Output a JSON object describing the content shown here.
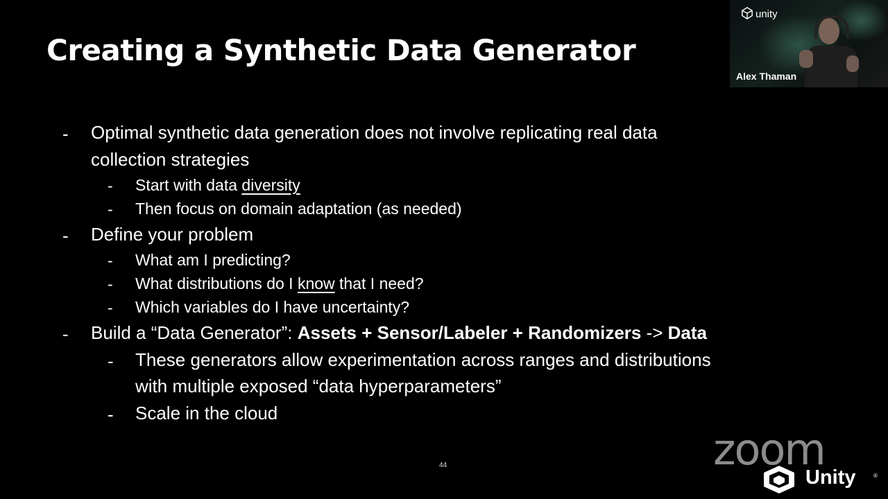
{
  "slide": {
    "title": "Creating a Synthetic Data Generator",
    "page_number": "44",
    "bullets": {
      "b1_line1": "Optimal synthetic data generation does not involve replicating real data",
      "b1_line2": "collection strategies",
      "b1_sub1_prefix": "Start with data ",
      "b1_sub1_underline": "diversity",
      "b1_sub2": "Then focus on domain adaptation (as needed)",
      "b2": "Define your problem",
      "b2_sub1": "What am I predicting?",
      "b2_sub2_prefix": "What distributions do I ",
      "b2_sub2_underline": "know",
      "b2_sub2_suffix": " that I need?",
      "b2_sub3": "Which variables do I have uncertainty?",
      "b3_prefix": "Build a “Data Generator”:  ",
      "b3_bold1": "Assets + Sensor/Labeler + Randomizers",
      "b3_arrow": " -> ",
      "b3_bold2": "Data",
      "b3_sub1_line1": "These generators allow experimentation across ranges and distributions",
      "b3_sub1_line2": "with multiple exposed “data hyperparameters”",
      "b3_sub2": "Scale in the cloud"
    },
    "dash": "-"
  },
  "video": {
    "logo_text": "unity",
    "speaker_name": "Alex Thaman"
  },
  "watermarks": {
    "zoom": "zoom",
    "unity": "Unity",
    "unity_reg": "®"
  },
  "colors": {
    "background": "#000000",
    "text": "#ffffff"
  }
}
